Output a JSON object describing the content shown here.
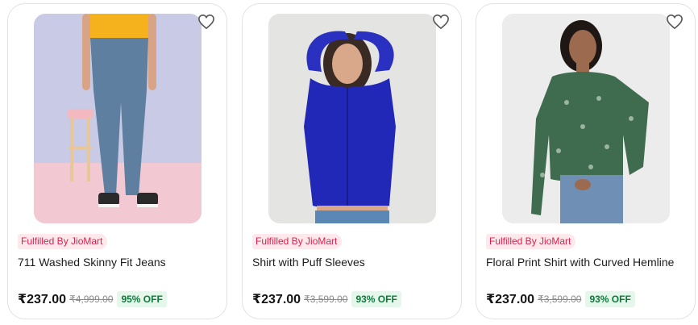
{
  "products": [
    {
      "image": "woman-in-skinny-jeans-photo",
      "fulfilled_label": "Fulfilled By JioMart",
      "title": "711 Washed Skinny Fit Jeans",
      "price": "₹237.00",
      "mrp": "₹4,999.00",
      "discount": "95% OFF"
    },
    {
      "image": "woman-in-blue-satin-shirt-photo",
      "fulfilled_label": "Fulfilled By JioMart",
      "title": "Shirt with Puff Sleeves",
      "price": "₹237.00",
      "mrp": "₹3,599.00",
      "discount": "93% OFF"
    },
    {
      "image": "woman-in-green-floral-shirt-photo",
      "fulfilled_label": "Fulfilled By JioMart",
      "title": "Floral Print Shirt with Curved Hemline",
      "price": "₹237.00",
      "mrp": "₹3,599.00",
      "discount": "93% OFF"
    }
  ],
  "colors": {
    "fulfilled_text": "#d9204f",
    "fulfilled_bg": "#fde8ec",
    "discount_text": "#0c7a3b",
    "discount_bg": "#e5f6ea"
  },
  "icons": {
    "wishlist": "heart-outline-icon"
  }
}
